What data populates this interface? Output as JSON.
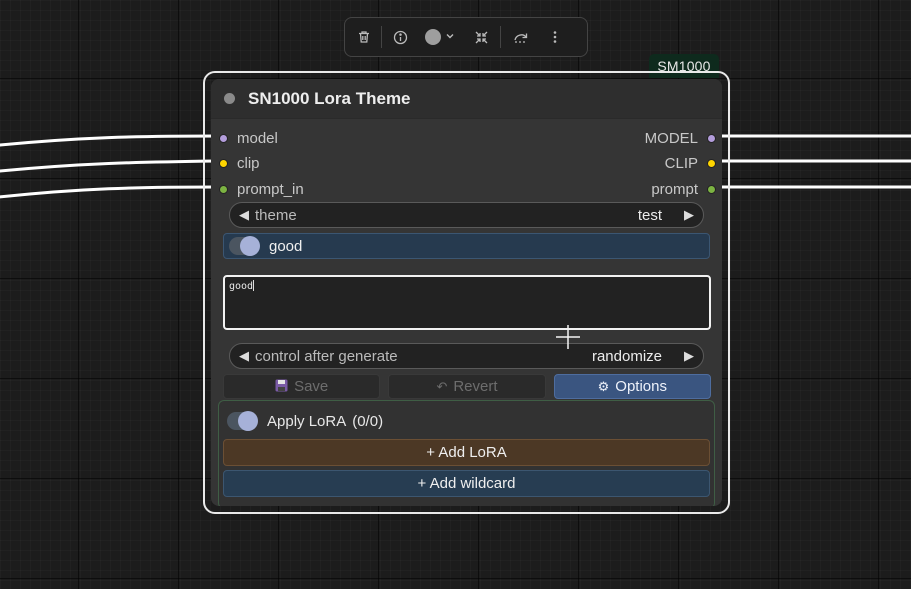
{
  "node": {
    "badge": "SM1000",
    "title": "SN1000 Lora Theme",
    "inputs": [
      {
        "label": "model",
        "color": "#b39ddb"
      },
      {
        "label": "clip",
        "color": "#ffd500"
      },
      {
        "label": "prompt_in",
        "color": "#7cb342"
      }
    ],
    "outputs": [
      {
        "label": "MODEL",
        "color": "#b39ddb"
      },
      {
        "label": "CLIP",
        "color": "#ffd500"
      },
      {
        "label": "prompt",
        "color": "#7cb342"
      }
    ],
    "theme_widget": {
      "label": "theme",
      "value": "test"
    },
    "good_toggle": {
      "label": "good",
      "on": true
    },
    "text_value": "good",
    "control_widget": {
      "label": "control after generate",
      "value": "randomize"
    },
    "buttons": {
      "save": "Save",
      "revert": "Revert",
      "options": "Options"
    },
    "lora": {
      "toggle_label": "Apply LoRA",
      "count": "(0/0)",
      "add_lora": "+ Add LoRA",
      "add_wildcard": "+ Add wildcard"
    }
  },
  "toolbar": {
    "icons": [
      "trash-icon",
      "info-icon",
      "color-circle-icon",
      "chevron-down-icon",
      "collapse-icon",
      "bypass-icon",
      "more-icon"
    ],
    "color_swatch": "#9e9e9e"
  },
  "colors": {
    "canvas": "#1c1c1c",
    "node_body": "#353535",
    "wire": "#ffffff",
    "options_accent": "#3a5580"
  }
}
